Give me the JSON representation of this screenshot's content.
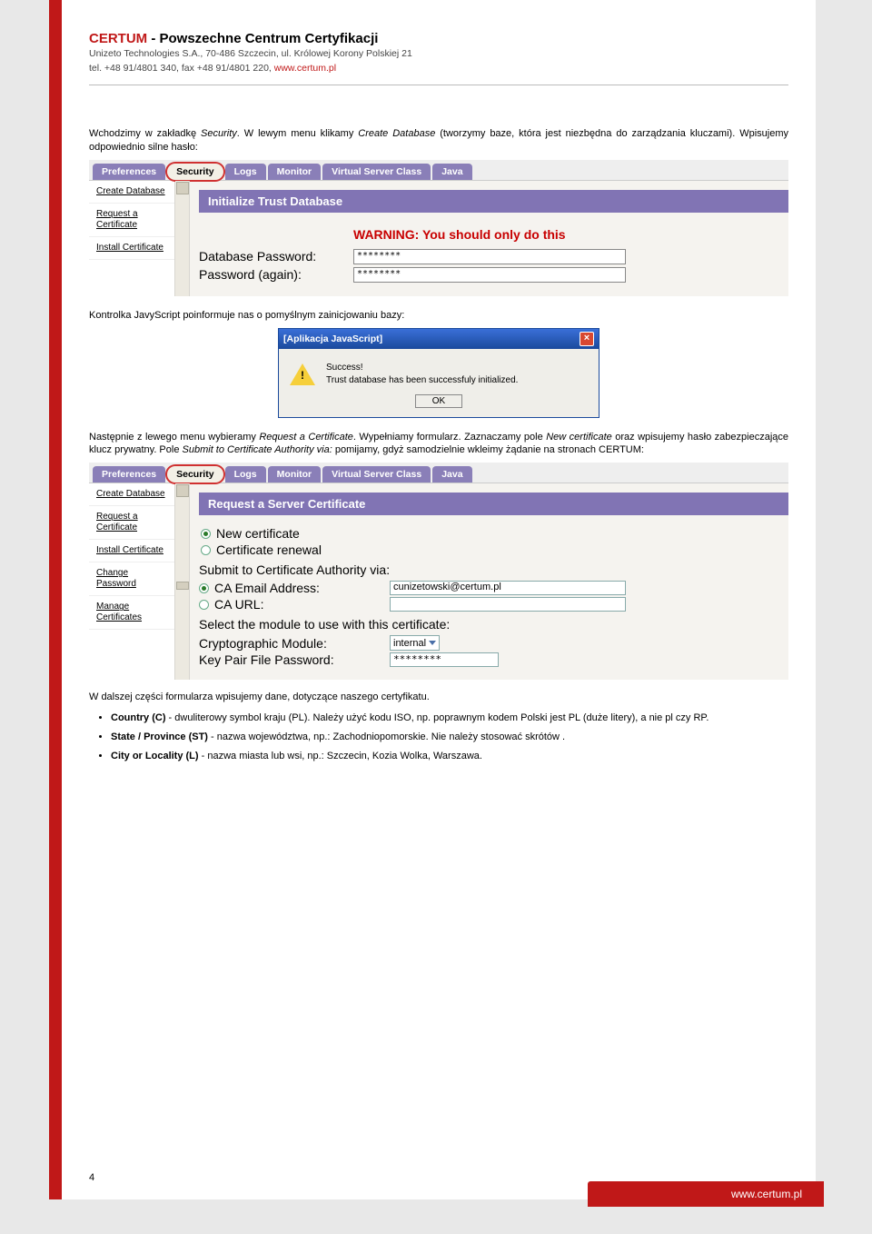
{
  "header": {
    "title_pre": "CERTUM",
    "title_post": " - Powszechne Centrum Certyfikacji",
    "sub": "Unizeto Technologies S.A., 70-486 Szczecin, ul. Królowej Korony Polskiej 21",
    "tel": "tel. +48 91/4801 340, fax +48 91/4801 220, ",
    "url": "www.certum.pl"
  },
  "para1_a": "Wchodzimy w zakładkę ",
  "para1_i1": "Security",
  "para1_b": ". W lewym menu klikamy ",
  "para1_i2": "Create Database",
  "para1_c": " (tworzymy baze, która jest niezbędna do zarządzania kluczami). Wpisujemy odpowiednio silne hasło:",
  "tabs": [
    "Preferences",
    "Security",
    "Logs",
    "Monitor",
    "Virtual Server Class",
    "Java"
  ],
  "sidenav1": [
    "Create Database",
    "Request a Certificate",
    "Install Certificate"
  ],
  "banner1": "Initialize Trust Database",
  "warning": "WARNING: You should only do this",
  "row1_label": "Database Password:",
  "row1_value": "********",
  "row2_label": "Password (again):",
  "row2_value": "********",
  "para2": "Kontrolka JavyScript poinformuje nas o pomyślnym zainicjowaniu bazy:",
  "dialog": {
    "title": "[Aplikacja JavaScript]",
    "line1": "Success!",
    "line2": "Trust database has been successfuly initialized.",
    "ok": "OK"
  },
  "para3_a": "Następnie z lewego menu wybieramy ",
  "para3_i1": "Request a Certificate",
  "para3_b": ". Wypełniamy formularz. Zaznaczamy pole ",
  "para3_i2": "New certificate",
  "para3_c": " oraz wpisujemy hasło zabezpieczające klucz prywatny. Pole ",
  "para3_i3": "Submit to Certificate Authority via:",
  "para3_d": " pomijamy, gdyż samodzielnie wkleimy żądanie na stronach CERTUM:",
  "sidenav2": [
    "Create Database",
    "Request a Certificate",
    "Install Certificate",
    "Change Password",
    "Manage Certificates"
  ],
  "banner2": "Request a Server Certificate",
  "opt_new": "New certificate",
  "opt_renew": "Certificate renewal",
  "submit_label": "Submit to Certificate Authority via:",
  "ca_email_label": "CA Email Address:",
  "ca_email_value": "cunizetowski@certum.pl",
  "ca_url_label": "CA URL:",
  "select_module_label": "Select the module to use with this certificate:",
  "crypto_label": "Cryptographic Module:",
  "crypto_value": "internal",
  "keypair_label": "Key Pair File Password:",
  "keypair_value": "********",
  "para4": "W dalszej części formularza wpisujemy dane, dotyczące naszego certyfikatu.",
  "bul1_b": "Country (C)",
  "bul1_t": " - dwuliterowy symbol kraju (PL). Należy użyć kodu ISO, np. poprawnym kodem Polski jest PL (duże litery), a nie pl czy RP.",
  "bul2_b": "State / Province (ST)",
  "bul2_t": " - nazwa województwa, np.: Zachodniopomorskie. Nie należy stosować skrótów .",
  "bul3_b": "City or Locality (L)",
  "bul3_t": " - nazwa miasta lub wsi, np.: Szczecin, Kozia Wolka, Warszawa.",
  "page_number": "4",
  "footer_url": "www.certum.pl"
}
